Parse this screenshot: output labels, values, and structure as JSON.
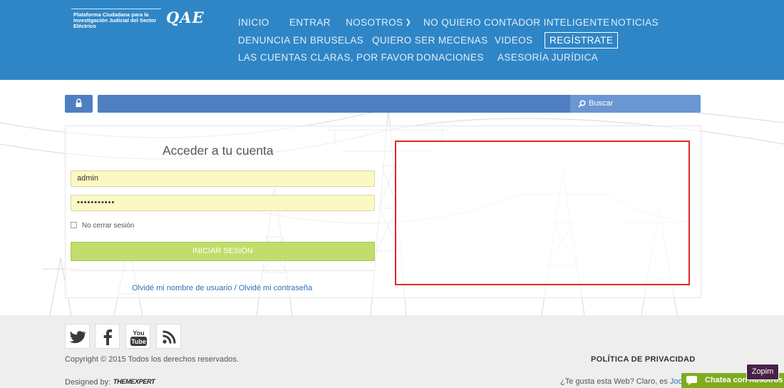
{
  "header": {
    "logo_text": "Plataforma Ciudadana para la Investigación Judicial del Sector Eléctrico",
    "logo_brand": "QAE",
    "nav": [
      {
        "label": "INICIO"
      },
      {
        "label": "ENTRAR"
      },
      {
        "label": "NOSOTROS"
      },
      {
        "label": "NO QUIERO CONTADOR INTELIGENTE"
      },
      {
        "label": "NOTICIAS"
      },
      {
        "label": "DENUNCIA EN BRUSELAS"
      },
      {
        "label": "QUIERO SER MECENAS"
      },
      {
        "label": "VIDEOS"
      },
      {
        "label": "REGÍSTRATE"
      },
      {
        "label": "LAS CUENTAS CLARAS, POR FAVOR"
      },
      {
        "label": "DONACIONES"
      },
      {
        "label": "ASESORÍA JURÍDICA"
      }
    ],
    "nosotros_icon": "chevron-down-icon"
  },
  "search": {
    "lock_icon": "lock-icon",
    "search_icon": "search-icon",
    "button_label": "Buscar",
    "value": ""
  },
  "login": {
    "title": "Acceder a tu cuenta",
    "username": "admin",
    "password_masked": "•••••••••••",
    "remember_label": "No cerrar sesión",
    "submit_label": "INICIAR SESIÓN",
    "forgot_username": "Olvidé mi nombre de usuario",
    "separator": "/",
    "forgot_password": "Olvidé mi contraseña"
  },
  "footer": {
    "social": [
      "twitter-icon",
      "facebook-icon",
      "youtube-icon",
      "rss-icon"
    ],
    "copyright": "Copyright © 2015 Todos los derechos reservados.",
    "privacy": "POLÍTICA DE PRIVACIDAD",
    "designed_by": "Designed by:",
    "designer": "THEMEXPERT",
    "like_text": "¿Te gusta esta Web? Claro, es",
    "like_link": "Joo"
  },
  "chat": {
    "zopim_label": "Zopim",
    "bar_label": "Chatea con nosotros"
  },
  "colors": {
    "header_bg": "#2f86c6",
    "search_bg": "#4f7fc1",
    "login_button": "#c1dd6b",
    "ad_border": "#e12727",
    "chat_green": "#7fac1f",
    "zopim_purple": "#462247"
  }
}
